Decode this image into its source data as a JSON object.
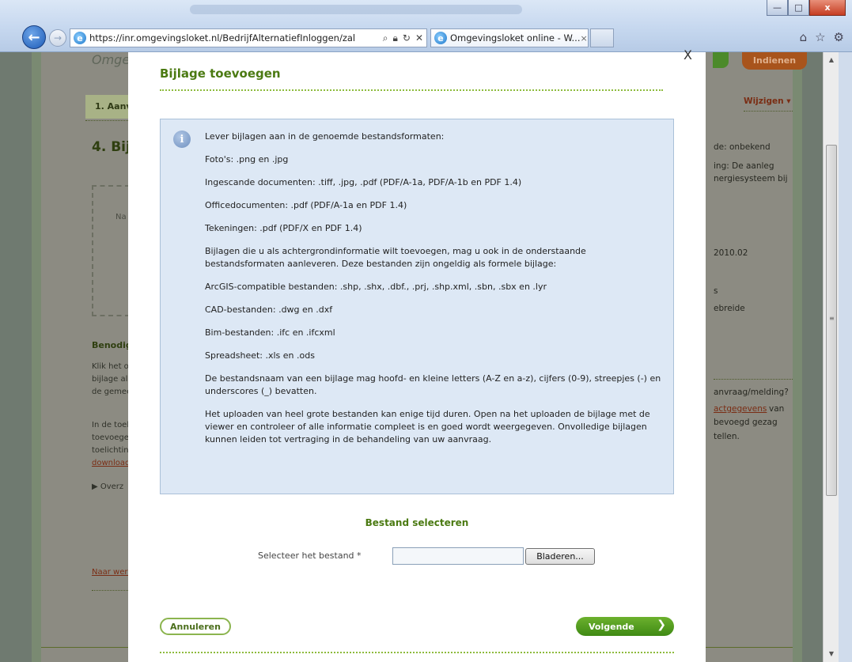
{
  "browser": {
    "address_url": "https://inr.omgevingsloket.nl/BedrijfAlternatiefInloggen/zal",
    "address_domain": "omgevingsloket.nl",
    "tab_title": "Omgevingsloket online - W...",
    "tab_close": "×",
    "window_controls": {
      "minimize": "—",
      "maximize": "□",
      "close": "x"
    },
    "icons": [
      "back-arrow-icon",
      "forward-arrow-icon",
      "ie-icon",
      "search-icon",
      "lock-icon",
      "refresh-icon",
      "stop-icon",
      "home-icon",
      "star-icon",
      "gear-icon"
    ]
  },
  "background_page": {
    "logo_text": "Omge",
    "step_tab": "1. Aanvr",
    "heading": "4. Bijl",
    "dash_text": "Na h",
    "section_bold": "Benodig",
    "left_lines": [
      "Klik het o",
      "bijlage al t",
      "de gemee"
    ],
    "left_lines2": [
      "In de toel",
      "toevoeger",
      "toelichtin"
    ],
    "left_link": "download",
    "overzicht": "▶ Overz",
    "naar_werk": "Naar werk",
    "top_button": "Indienen",
    "wijzigen": "Wijzigen ▾",
    "right_lines": [
      "de: onbekend",
      "ing: De aanleg",
      "nergiesysteem bij"
    ],
    "right_value": "2010.02",
    "right_s": "s",
    "right_uitgebreide": "ebreide",
    "right_vraag": "anvraag/melding?",
    "right_link": "actgegevens",
    "right_van": "van",
    "right_bevoegd": "bevoegd gezag",
    "right_stellen": "tellen."
  },
  "modal": {
    "close_label": "X",
    "title": "Bijlage toevoegen",
    "info_lines": [
      "Lever bijlagen aan in de genoemde bestandsformaten:",
      "Foto's: .png en .jpg",
      "Ingescande documenten: .tiff, .jpg, .pdf (PDF/A-1a, PDF/A-1b en PDF 1.4)",
      "Officedocumenten: .pdf (PDF/A-1a en PDF 1.4)",
      "Tekeningen: .pdf (PDF/X en PDF 1.4)",
      "Bijlagen die u als achtergrondinformatie wilt toevoegen, mag u ook in de onderstaande bestandsformaten aanleveren. Deze bestanden zijn ongeldig als formele bijlage:",
      "ArcGIS-compatible bestanden: .shp, .shx, .dbf., .prj, .shp.xml, .sbn, .sbx en .lyr",
      "CAD-bestanden: .dwg en .dxf",
      "Bim-bestanden: .ifc en .ifcxml",
      "Spreadsheet: .xls en .ods",
      "De bestandsnaam van een bijlage mag hoofd- en kleine letters (A-Z en a-z), cijfers (0-9), streepjes (-) en underscores (_) bevatten.",
      "Het uploaden van heel grote bestanden kan enige tijd duren. Open na het uploaden de bijlage met de viewer en controleer of alle informatie compleet is en goed wordt weergegeven. Onvolledige bijlagen kunnen leiden tot vertraging in de behandeling van uw aanvraag."
    ],
    "section_title": "Bestand selecteren",
    "file_label": "Selecteer het bestand *",
    "file_value": "",
    "browse_button": "Bladeren...",
    "cancel_button": "Annuleren",
    "next_button": "Volgende",
    "next_chevron": "❯"
  },
  "colors": {
    "accent_green": "#4b7a12",
    "info_bg": "#dde8f5",
    "next_btn": "#52a01f"
  }
}
